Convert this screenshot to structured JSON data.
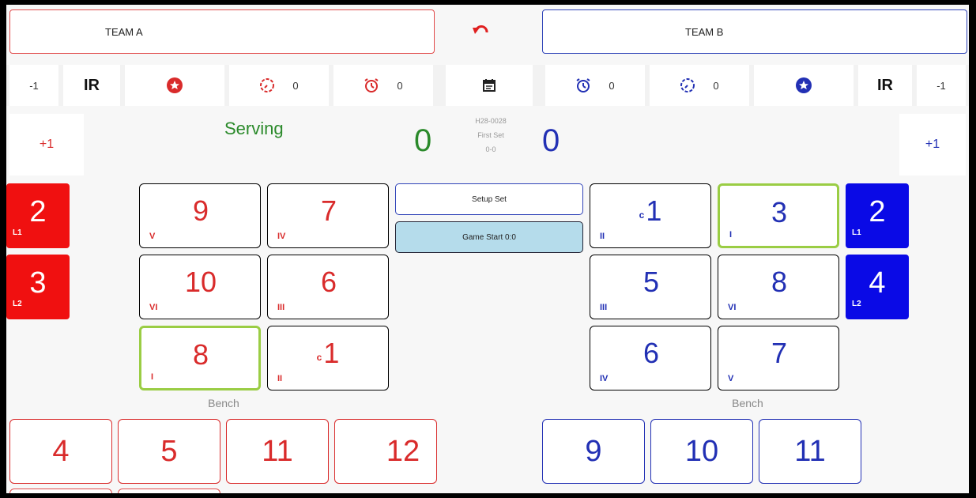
{
  "header": {
    "team_a": "TEAM A",
    "team_b": "TEAM B",
    "undo_icon": "undo-icon"
  },
  "toolbar": {
    "left": {
      "minus_one": "-1",
      "ir": "IR",
      "timeout_count": "0",
      "alarm_count": "0"
    },
    "right": {
      "alarm_count": "0",
      "timeout_count": "0",
      "ir": "IR",
      "minus_one": "-1"
    },
    "icons": [
      "star-icon",
      "timer-icon",
      "alarm-icon",
      "calendar-icon"
    ]
  },
  "score": {
    "plus_left": "+1",
    "plus_right": "+1",
    "serving": "Serving",
    "team_a_score": "0",
    "team_b_score": "0",
    "match_code": "H28-0028",
    "set_name": "First Set",
    "set_score": "0-0"
  },
  "controls": {
    "setup_set": "Setup Set",
    "game_start": "Game Start 0:0"
  },
  "team_a": {
    "liberos": [
      {
        "number": "2",
        "tag": "L1"
      },
      {
        "number": "3",
        "tag": "L2"
      }
    ],
    "court": [
      {
        "number": "9",
        "position": "V",
        "captain": ""
      },
      {
        "number": "7",
        "position": "IV",
        "captain": ""
      },
      {
        "number": "10",
        "position": "VI",
        "captain": ""
      },
      {
        "number": "6",
        "position": "III",
        "captain": ""
      },
      {
        "number": "8",
        "position": "I",
        "captain": ""
      },
      {
        "number": "1",
        "position": "II",
        "captain": "c"
      }
    ],
    "bench_label": "Bench",
    "bench": [
      "4",
      "5",
      "11",
      "12"
    ]
  },
  "team_b": {
    "liberos": [
      {
        "number": "2",
        "tag": "L1"
      },
      {
        "number": "4",
        "tag": "L2"
      }
    ],
    "court": [
      {
        "number": "1",
        "position": "II",
        "captain": "c"
      },
      {
        "number": "3",
        "position": "I",
        "captain": ""
      },
      {
        "number": "5",
        "position": "III",
        "captain": ""
      },
      {
        "number": "8",
        "position": "VI",
        "captain": ""
      },
      {
        "number": "6",
        "position": "IV",
        "captain": ""
      },
      {
        "number": "7",
        "position": "V",
        "captain": ""
      }
    ],
    "bench_label": "Bench",
    "bench": [
      "9",
      "10",
      "11"
    ]
  },
  "colors": {
    "team_a": "#d92b2b",
    "team_b": "#2230b4",
    "libero_a": "#f01010",
    "libero_b": "#0a0ae6",
    "server_highlight": "#9acd44",
    "score_a": "#2b8a2b"
  }
}
